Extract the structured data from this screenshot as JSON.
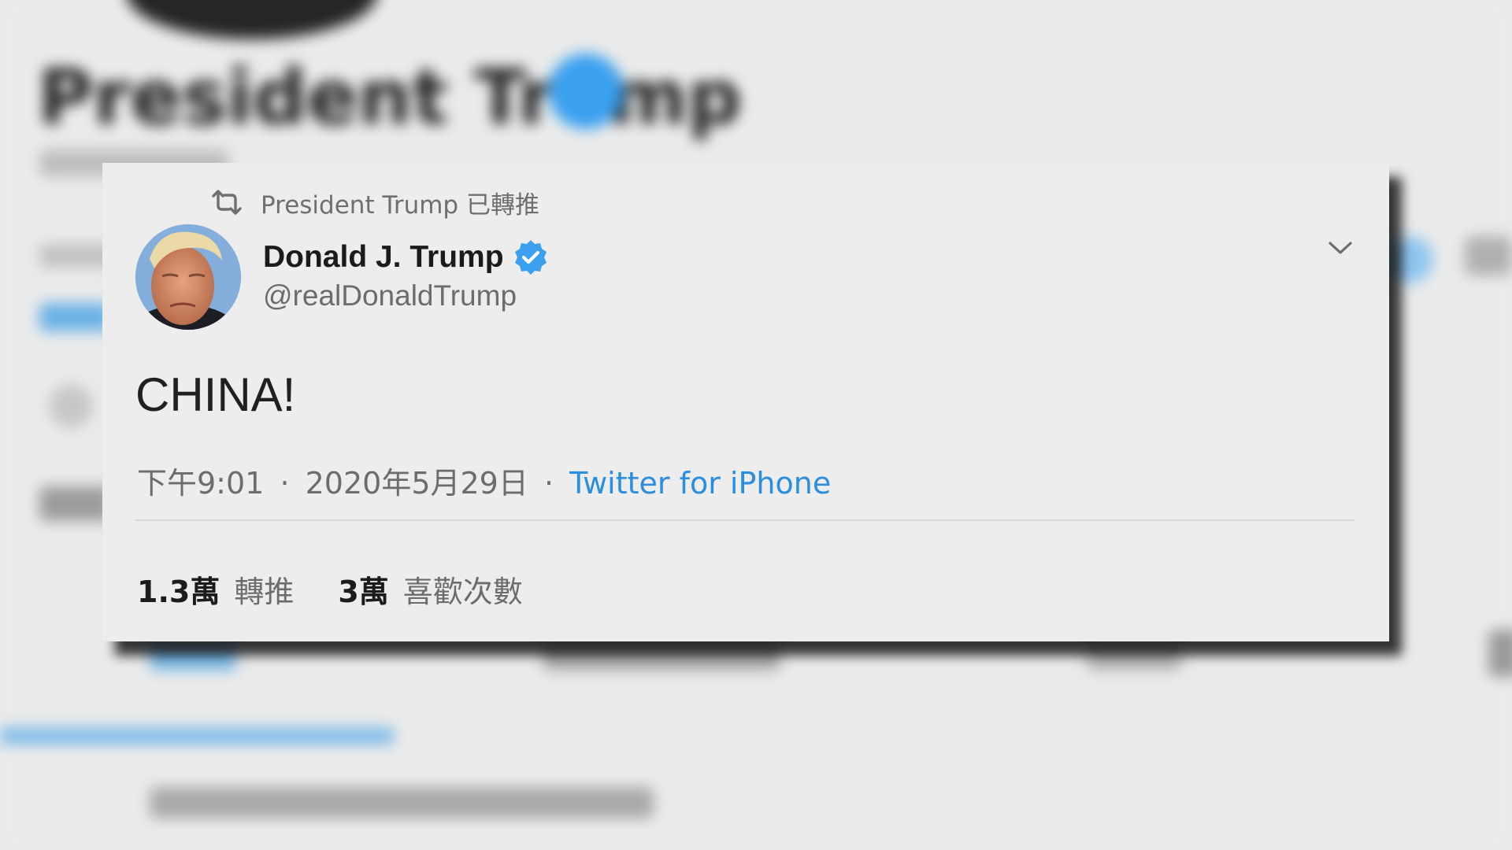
{
  "background": {
    "profile_name": "President Trump"
  },
  "tweet": {
    "retweet_banner": {
      "icon": "retweet-icon",
      "text": "President Trump 已轉推"
    },
    "author": {
      "display_name": "Donald J. Trump",
      "handle": "@realDonaldTrump",
      "verified": true
    },
    "text": "CHINA!",
    "meta": {
      "time": "下午9:01",
      "separator": "·",
      "date": "2020年5月29日",
      "source": "Twitter for iPhone"
    },
    "stats": {
      "retweets_count": "1.3萬",
      "retweets_label": "轉推",
      "likes_count": "3萬",
      "likes_label": "喜歡次數"
    },
    "menu_icon": "chevron-down-icon"
  },
  "colors": {
    "accent": "#2b8ee0",
    "verified_badge": "#3aa0ef",
    "card_background": "#ededed",
    "page_background": "#e9e9e9"
  }
}
